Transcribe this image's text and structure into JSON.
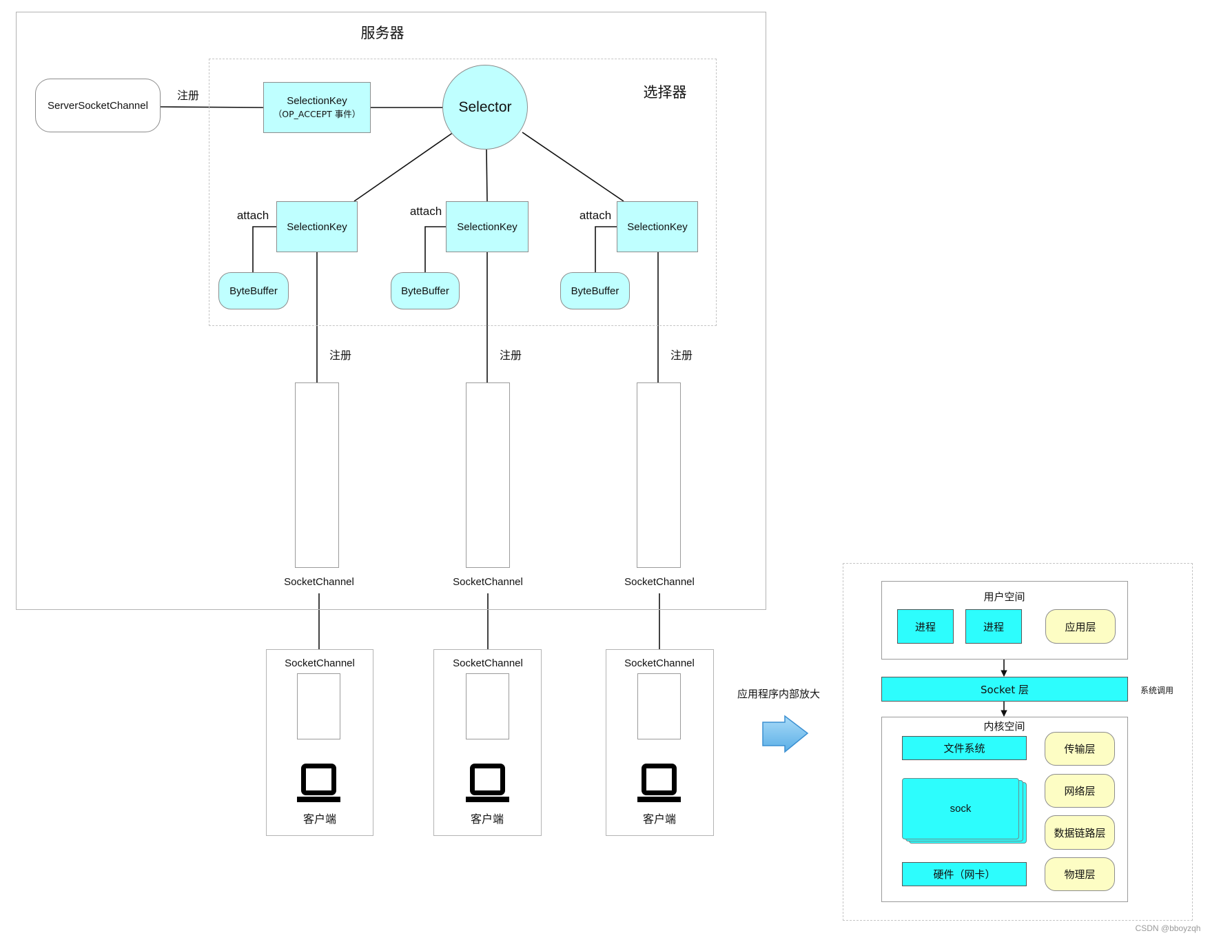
{
  "server": {
    "title": "服务器",
    "server_socket_channel": "ServerSocketChannel",
    "register_label": "注册",
    "selector_group": {
      "title": "选择器",
      "accept_key": {
        "label": "SelectionKey",
        "sub": "（OP_ACCEPT 事件）"
      },
      "selector_label": "Selector",
      "branches": [
        {
          "key_label": "SelectionKey",
          "attach_label": "attach",
          "buffer_label": "ByteBuffer",
          "register_label": "注册",
          "channel_label": "SocketChannel"
        },
        {
          "key_label": "SelectionKey",
          "attach_label": "attach",
          "buffer_label": "ByteBuffer",
          "register_label": "注册",
          "channel_label": "SocketChannel"
        },
        {
          "key_label": "SelectionKey",
          "attach_label": "attach",
          "buffer_label": "ByteBuffer",
          "register_label": "注册",
          "channel_label": "SocketChannel"
        }
      ]
    }
  },
  "clients": [
    {
      "channel_label": "SocketChannel",
      "client_label": "客户端",
      "icon": "computer-icon"
    },
    {
      "channel_label": "SocketChannel",
      "client_label": "客户端",
      "icon": "computer-icon"
    },
    {
      "channel_label": "SocketChannel",
      "client_label": "客户端",
      "icon": "computer-icon"
    }
  ],
  "zoom_annotation": {
    "label": "应用程序内部放大",
    "icon": "arrow-right-icon"
  },
  "detail": {
    "user_space": {
      "title": "用户空间",
      "process_1": "进程",
      "process_2": "进程",
      "app_layer": "应用层"
    },
    "socket_layer": "Socket 层",
    "syscall_label": "系统调用",
    "kernel_space": {
      "title": "内核空间",
      "filesystem": "文件系统",
      "sock": "sock",
      "hardware": "硬件（网卡）",
      "layers": [
        "传输层",
        "网络层",
        "数据链路层",
        "物理层"
      ]
    }
  },
  "colors": {
    "light_cyan": "#bfffff",
    "cyan": "#2dfdfd",
    "pale_yellow": "#fdfdc4",
    "arrow_blue": "#5aaee6"
  },
  "watermark": "CSDN @bboyzqh"
}
